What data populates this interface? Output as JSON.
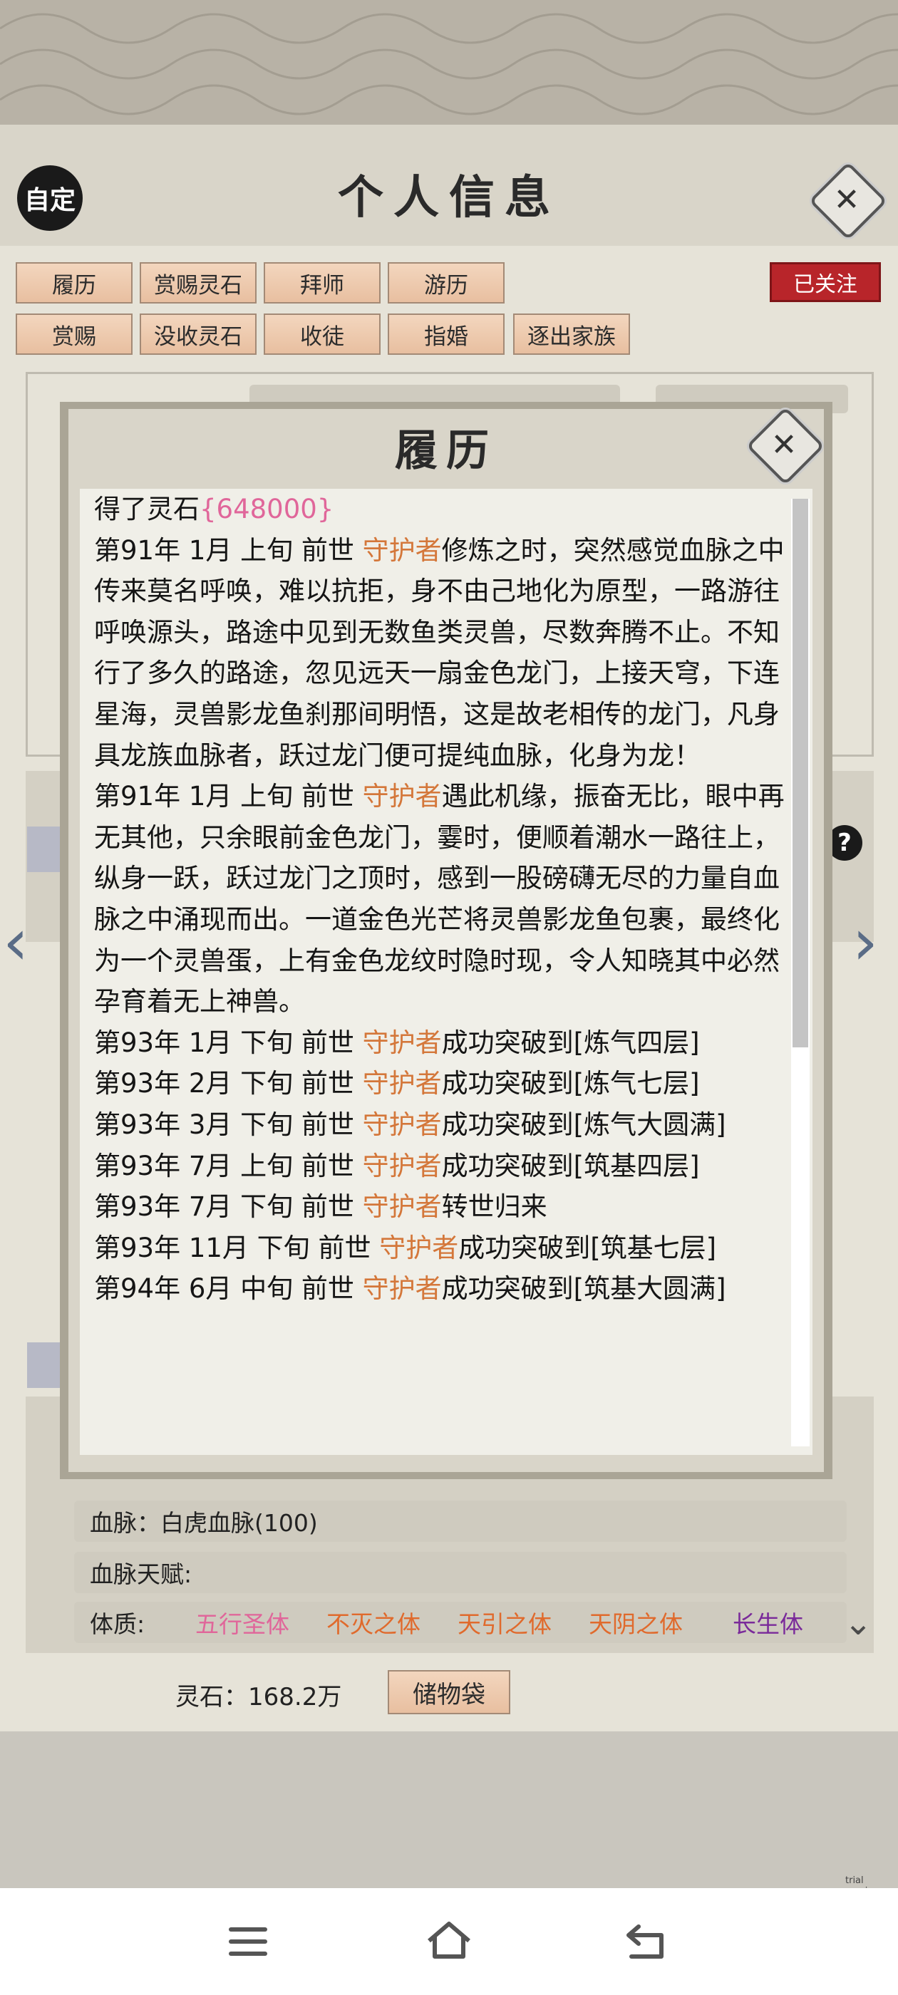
{
  "header": {
    "custom_label": "自定",
    "title": "个人信息"
  },
  "tabs": [
    "履历",
    "赏赐灵石",
    "拜师",
    "游历",
    "赏赐",
    "没收灵石",
    "收徒",
    "指婚",
    "逐出家族"
  ],
  "followed_label": "已关注",
  "dialog": {
    "title": "履历",
    "paragraphs": [
      {
        "parts": [
          {
            "t": "得了灵石"
          },
          {
            "t": "{648000}",
            "c": "pk"
          }
        ]
      },
      {
        "parts": [
          {
            "t": "第91年 1月 上旬  前世 "
          },
          {
            "t": "守护者",
            "c": "hl"
          },
          {
            "t": "修炼之时，突然感觉血脉之中传来莫名呼唤，难以抗拒，身不由己地化为原型，一路游往呼唤源头，路途中见到无数鱼类灵兽，尽数奔腾不止。不知行了多久的路途，忽见远天一扇金色龙门，上接天穹，下连星海，灵兽影龙鱼刹那间明悟，这是故老相传的龙门，凡身具龙族血脉者，跃过龙门便可提纯血脉，化身为龙！"
          }
        ]
      },
      {
        "parts": [
          {
            "t": "第91年 1月 上旬  前世 "
          },
          {
            "t": "守护者",
            "c": "hl"
          },
          {
            "t": "遇此机缘，振奋无比，眼中再无其他，只余眼前金色龙门，霎时，便顺着潮水一路往上，纵身一跃，跃过龙门之顶时，感到一股磅礴无尽的力量自血脉之中涌现而出。一道金色光芒将灵兽影龙鱼包裹，最终化为一个灵兽蛋，上有金色龙纹时隐时现，令人知晓其中必然孕育着无上神兽。"
          }
        ]
      },
      {
        "parts": [
          {
            "t": "第93年 1月 下旬   前世   "
          },
          {
            "t": "守护者",
            "c": "hl"
          },
          {
            "t": "成功突破到[炼气四层]"
          }
        ]
      },
      {
        "parts": [
          {
            "t": "第93年 2月 下旬   前世   "
          },
          {
            "t": "守护者",
            "c": "hl"
          },
          {
            "t": "成功突破到[炼气七层]"
          }
        ]
      },
      {
        "parts": [
          {
            "t": "第93年 3月 下旬  前世  "
          },
          {
            "t": "守护者",
            "c": "hl"
          },
          {
            "t": "成功突破到[炼气大圆满]"
          }
        ]
      },
      {
        "parts": [
          {
            "t": "第93年 7月 上旬   前世   "
          },
          {
            "t": "守护者",
            "c": "hl"
          },
          {
            "t": "成功突破到[筑基四层]"
          }
        ]
      },
      {
        "parts": [
          {
            "t": "第93年 7月 下旬   前世   "
          },
          {
            "t": "守护者",
            "c": "hl"
          },
          {
            "t": "转世归来"
          }
        ]
      },
      {
        "parts": [
          {
            "t": "第93年 11月 下旬  前世  "
          },
          {
            "t": "守护者",
            "c": "hl"
          },
          {
            "t": "成功突破到[筑基七层]"
          }
        ]
      },
      {
        "parts": [
          {
            "t": "第94年 6月 中旬  前世 "
          },
          {
            "t": "守护者",
            "c": "hl"
          },
          {
            "t": "成功突破到[筑基大圆满]"
          }
        ]
      }
    ]
  },
  "rows": {
    "bloodline_label": "血脉：",
    "bloodline_value": "白虎血脉(100)",
    "bloodline_talent_label": "血脉天赋:",
    "physique_label": "体质:",
    "physique_traits": [
      {
        "name": "五行圣体",
        "color": "#e0669a"
      },
      {
        "name": "不灭之体",
        "color": "#e06a2c"
      },
      {
        "name": "天引之体",
        "color": "#e06a2c"
      },
      {
        "name": "天阴之体",
        "color": "#e06a2c"
      },
      {
        "name": "长生体",
        "color": "#7a2a9a"
      }
    ]
  },
  "footer": {
    "spirit_stone_label": "灵石：168.2万",
    "storage_bag_label": "储物袋"
  },
  "watermark": "trial version",
  "colors": {
    "accent_orange": "#d4773a",
    "accent_pink": "#e0669a",
    "badge_red": "#b8252a"
  }
}
